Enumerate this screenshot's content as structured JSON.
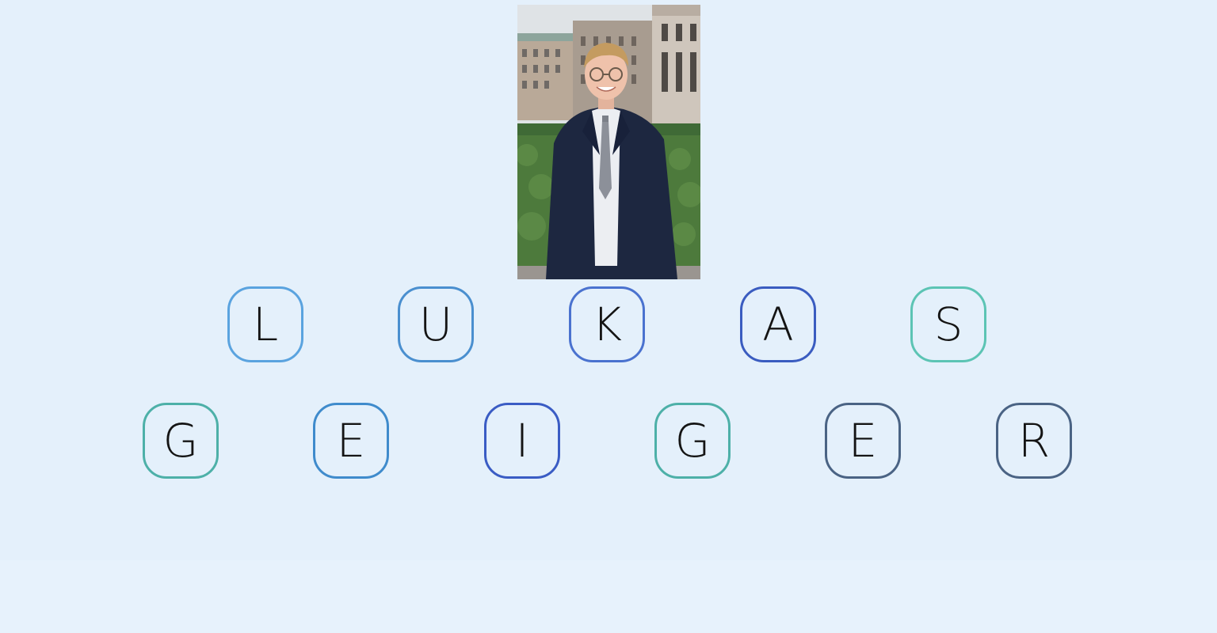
{
  "photo": {
    "subject": "portrait of a smiling man in a navy suit and grey tie standing outdoors in front of buildings and hedges"
  },
  "name_rows": [
    {
      "tiles": [
        {
          "letter": "L",
          "color": "#5aa3df"
        },
        {
          "letter": "U",
          "color": "#4a8fcf"
        },
        {
          "letter": "K",
          "color": "#4a72cf"
        },
        {
          "letter": "A",
          "color": "#3a5cc0"
        },
        {
          "letter": "S",
          "color": "#5cc4b4"
        }
      ]
    },
    {
      "tiles": [
        {
          "letter": "G",
          "color": "#4db0a8"
        },
        {
          "letter": "E",
          "color": "#3f8bcc"
        },
        {
          "letter": "I",
          "color": "#3a5cc4"
        },
        {
          "letter": "G",
          "color": "#4db0a8"
        },
        {
          "letter": "E",
          "color": "#4a6384"
        },
        {
          "letter": "R",
          "color": "#4a6384"
        }
      ]
    }
  ],
  "colors": {
    "background": "#e4f0fb",
    "letter": "#141414"
  }
}
